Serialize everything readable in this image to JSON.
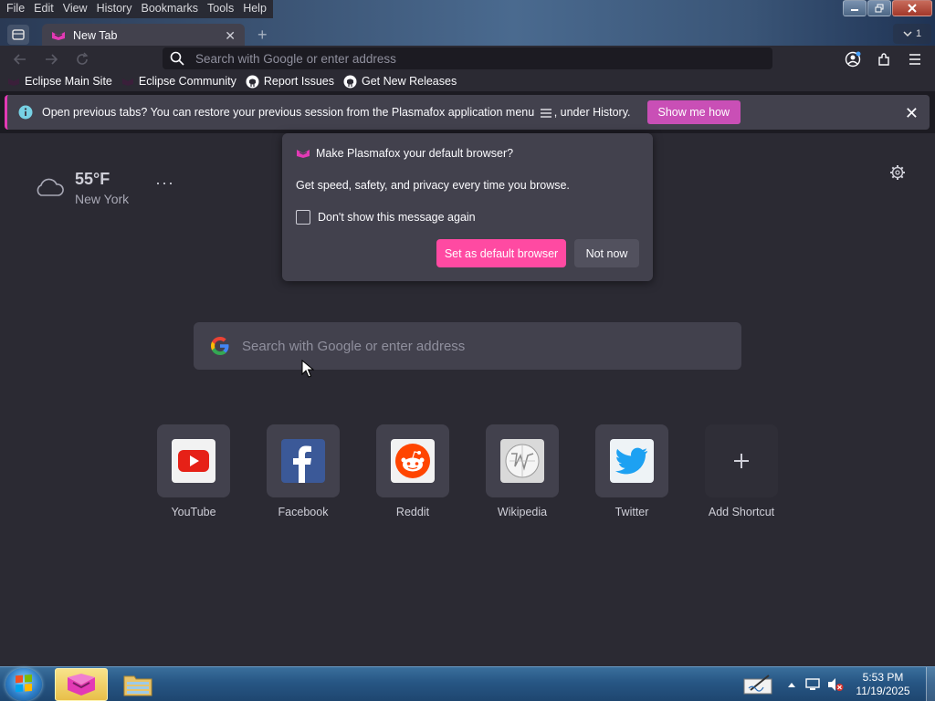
{
  "menu": [
    "File",
    "Edit",
    "View",
    "History",
    "Bookmarks",
    "Tools",
    "Help"
  ],
  "tab": {
    "title": "New Tab",
    "list_count": "1"
  },
  "urlbar": {
    "placeholder": "Search with Google or enter address"
  },
  "bookmarks": [
    {
      "label": "Eclipse Main Site",
      "icon": "eclipse-icon"
    },
    {
      "label": "Eclipse Community",
      "icon": "eclipse-icon"
    },
    {
      "label": "Report Issues",
      "icon": "github-icon"
    },
    {
      "label": "Get New Releases",
      "icon": "github-icon"
    }
  ],
  "notice": {
    "text_before": "Open previous tabs?",
    "text_after": "You can restore your previous session from the Plasmafox application menu",
    "text_end": ", under History.",
    "button": "Show me how"
  },
  "weather": {
    "temp": "55°F",
    "city": "New York"
  },
  "popup": {
    "title": "Make Plasmafox your default browser?",
    "body": "Get speed, safety, and privacy every time you browse.",
    "checkbox_label": "Don't show this message again",
    "primary": "Set as default browser",
    "secondary": "Not now"
  },
  "search": {
    "placeholder": "Search with Google or enter address"
  },
  "shortcuts": [
    {
      "label": "YouTube",
      "icon": "youtube-icon",
      "color": "#e62117"
    },
    {
      "label": "Facebook",
      "icon": "facebook-icon",
      "color": "#3b5998"
    },
    {
      "label": "Reddit",
      "icon": "reddit-icon",
      "color": "#ff4500"
    },
    {
      "label": "Wikipedia",
      "icon": "wikipedia-icon",
      "color": "#dcdcdc"
    },
    {
      "label": "Twitter",
      "icon": "twitter-icon",
      "color": "#1da1f2"
    },
    {
      "label": "Add Shortcut",
      "icon": "plus-icon",
      "color": "#cfcfd8"
    }
  ],
  "taskbar": {
    "time": "5:53 PM",
    "date": "11/19/2025"
  },
  "colors": {
    "accent": "#ff4aa2",
    "notice_button": "#c94fb6",
    "content_bg": "#2b2a33",
    "card_bg": "#42414d"
  }
}
